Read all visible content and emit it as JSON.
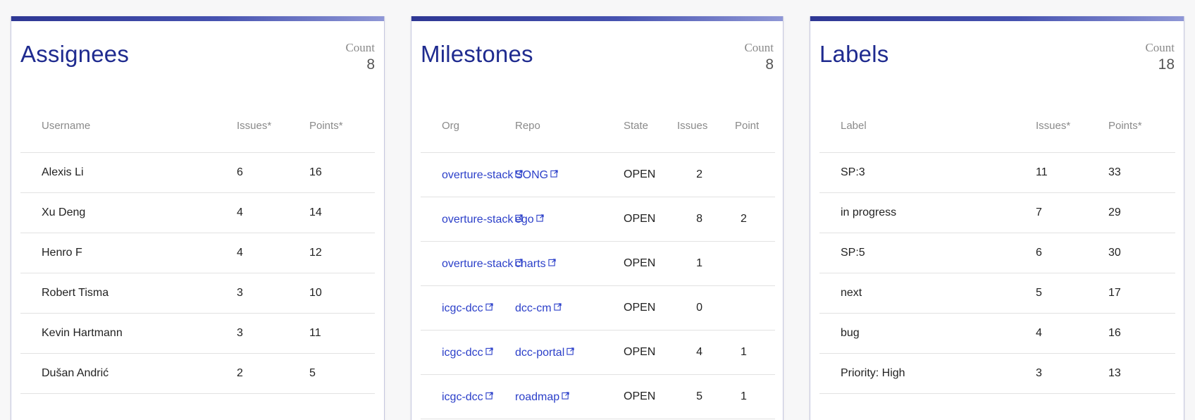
{
  "assignees": {
    "title": "Assignees",
    "count_label": "Count",
    "count": "8",
    "columns": [
      "Username",
      "Issues*",
      "Points*"
    ],
    "rows": [
      {
        "name": "Alexis Li",
        "issues": "6",
        "points": "16"
      },
      {
        "name": "Xu Deng",
        "issues": "4",
        "points": "14"
      },
      {
        "name": "Henro F",
        "issues": "4",
        "points": "12"
      },
      {
        "name": "Robert Tisma",
        "issues": "3",
        "points": "10"
      },
      {
        "name": "Kevin Hartmann",
        "issues": "3",
        "points": "11"
      },
      {
        "name": "Dušan Andrić",
        "issues": "2",
        "points": "5"
      }
    ]
  },
  "milestones": {
    "title": "Milestones",
    "count_label": "Count",
    "count": "8",
    "columns": [
      "Org",
      "Repo",
      "State",
      "Issues",
      "Point"
    ],
    "rows": [
      {
        "org": "overture-stack",
        "repo": "SONG",
        "state": "OPEN",
        "issues": "2",
        "points": ""
      },
      {
        "org": "overture-stack",
        "repo": "ego",
        "state": "OPEN",
        "issues": "8",
        "points": "2"
      },
      {
        "org": "overture-stack",
        "repo": "charts",
        "state": "OPEN",
        "issues": "1",
        "points": ""
      },
      {
        "org": "icgc-dcc",
        "repo": "dcc-cm",
        "state": "OPEN",
        "issues": "0",
        "points": ""
      },
      {
        "org": "icgc-dcc",
        "repo": "dcc-portal",
        "state": "OPEN",
        "issues": "4",
        "points": "1"
      },
      {
        "org": "icgc-dcc",
        "repo": "roadmap",
        "state": "OPEN",
        "issues": "5",
        "points": "1"
      }
    ]
  },
  "labels": {
    "title": "Labels",
    "count_label": "Count",
    "count": "18",
    "columns": [
      "Label",
      "Issues*",
      "Points*"
    ],
    "rows": [
      {
        "label": "SP:3",
        "issues": "11",
        "points": "33"
      },
      {
        "label": "in progress",
        "issues": "7",
        "points": "29"
      },
      {
        "label": "SP:5",
        "issues": "6",
        "points": "30"
      },
      {
        "label": "next",
        "issues": "5",
        "points": "17"
      },
      {
        "label": "bug",
        "issues": "4",
        "points": "16"
      },
      {
        "label": "Priority: High",
        "issues": "3",
        "points": "13"
      }
    ]
  },
  "colors": {
    "accent": "#2e3794",
    "title": "#1f2b8f",
    "link": "#2b3fc9"
  },
  "icons": {
    "external_link": "external-link-icon"
  }
}
